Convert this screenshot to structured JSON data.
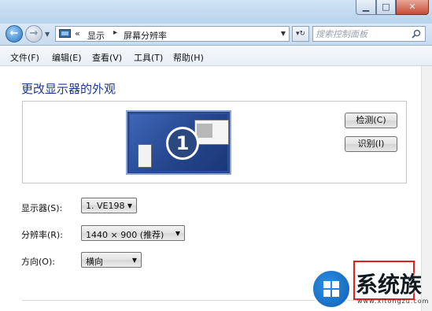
{
  "navigation": {
    "address": {
      "prefix": "«",
      "crumbs": [
        "显示",
        "屏幕分辨率"
      ],
      "separator": "▸"
    },
    "search": {
      "placeholder": "搜索控制面板"
    }
  },
  "menu": {
    "items": [
      "文件(F)",
      "编辑(E)",
      "查看(V)",
      "工具(T)",
      "帮助(H)"
    ]
  },
  "content": {
    "title": "更改显示器的外观",
    "preview": {
      "monitor_number": "1"
    },
    "buttons": {
      "detect": "检测(C)",
      "identify": "识别(I)"
    },
    "settings": {
      "display": {
        "label": "显示器(S):",
        "value": "1. VE198"
      },
      "resolution": {
        "label": "分辨率(R):",
        "value": "1440 × 900 (推荐)"
      },
      "orientation": {
        "label": "方向(O):",
        "value": "横向"
      }
    }
  },
  "watermark": {
    "text": "系统族",
    "url": "www.xitongzu.com"
  },
  "colors": {
    "title": "#1b3a8f",
    "highlight": "#d22222",
    "monitor": "#2b4f9b"
  }
}
